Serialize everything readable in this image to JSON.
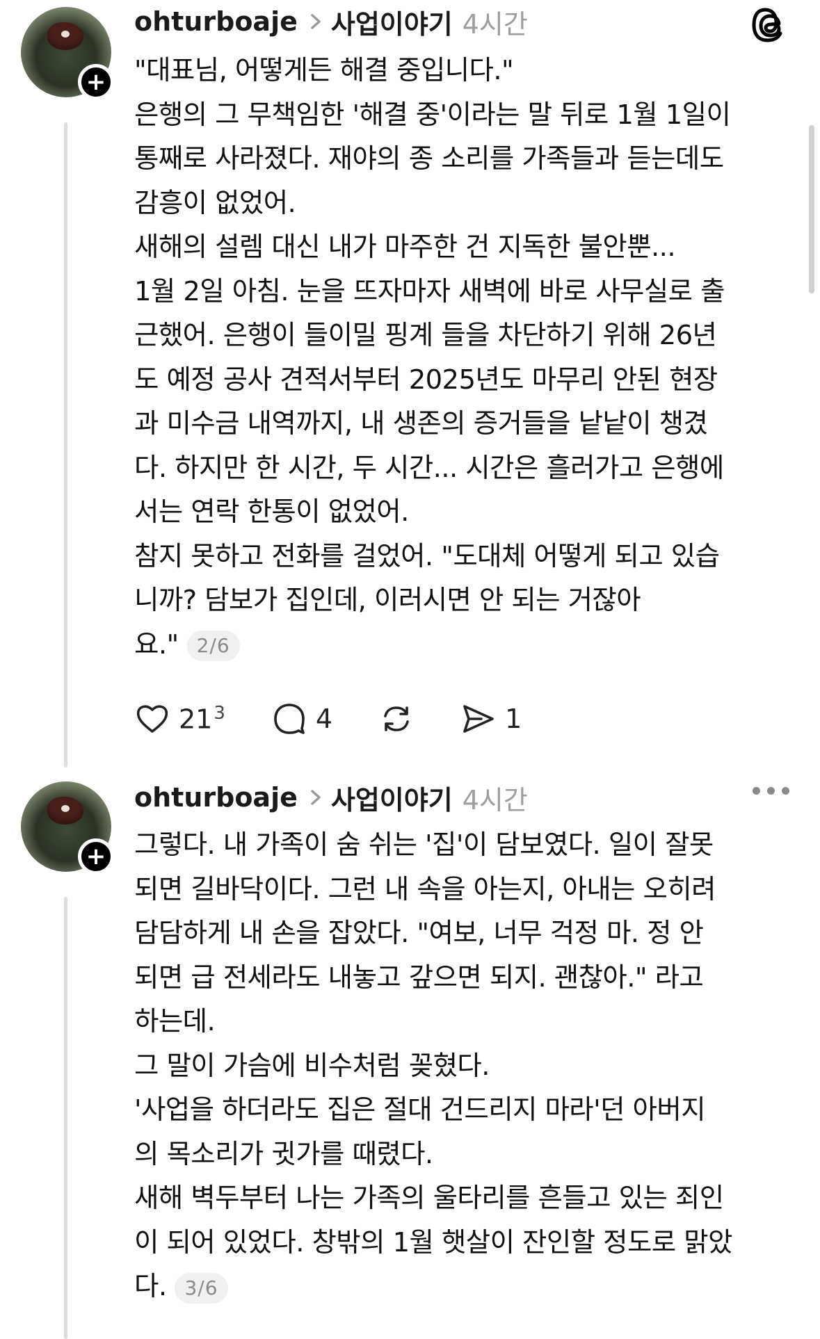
{
  "posts": [
    {
      "username": "ohturboaje",
      "topic": "사업이야기",
      "time": "4시간",
      "paragraphs": [
        "\"대표님, 어떻게든 해결 중입니다.\"",
        "은행의 그 무책임한 '해결 중'이라는 말 뒤로 1월 1일이\n통째로 사라졌다. 재야의 종 소리를 가족들과 듣는데도\n감흥이 없었어.",
        "새해의 설렘 대신 내가 마주한 건 지독한 불안뿐...",
        "1월 2일 아침. 눈을 뜨자마자 새벽에 바로 사무실로 출\n근했어. 은행이 들이밀 핑계 들을 차단하기 위해 26년\n도 예정 공사 견적서부터 2025년도 마무리 안된 현장\n과 미수금 내역까지, 내 생존의 증거들을 낱낱이 챙겼\n다. 하지만 한 시간, 두 시간... 시간은 흘러가고 은행에\n서는 연락 한통이 없었어.",
        "참지 못하고 전화를 걸었어. \"도대체 어떻게 되고 있습\n니까? 담보가 집인데, 이러시면 안 되는 거잖아\n요.\""
      ],
      "pager": "2/6",
      "likes": "21",
      "likes_sup": "3",
      "comments": "4",
      "shares": "1"
    },
    {
      "username": "ohturboaje",
      "topic": "사업이야기",
      "time": "4시간",
      "paragraphs": [
        "그렇다. 내 가족이 숨 쉬는 '집'이 담보였다. 일이 잘못\n되면 길바닥이다. 그런 내 속을 아는지, 아내는 오히려\n담담하게 내 손을 잡았다. \"여보, 너무 걱정 마. 정 안\n되면 급 전세라도 내놓고 갚으면 되지. 괜찮아.\" 라고\n하는데.",
        "그 말이 가슴에 비수처럼 꽂혔다.",
        "'사업을 하더라도 집은 절대 건드리지 마라'던 아버지\n의 목소리가 귓가를 때렸다.",
        "새해 벽두부터 나는 가족의 울타리를 흔들고 있는 죄인\n이 되어 있었다. 창밖의 1월 햇살이 잔인할 정도로 맑았\n다."
      ],
      "pager": "3/6"
    }
  ]
}
